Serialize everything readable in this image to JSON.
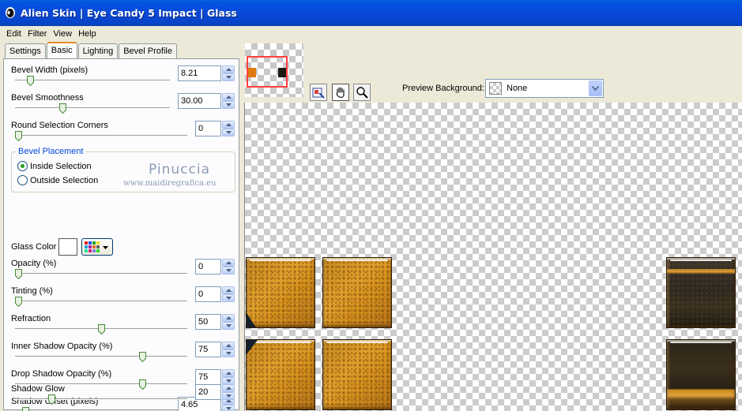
{
  "window": {
    "title": "Alien Skin | Eye Candy 5 Impact | Glass"
  },
  "menu": [
    "Edit",
    "Filter",
    "View",
    "Help"
  ],
  "tabs": [
    "Settings",
    "Basic",
    "Lighting",
    "Bevel Profile"
  ],
  "active_tab": "Basic",
  "controls": {
    "bevel_width": {
      "label": "Bevel Width (pixels)",
      "value": "8.21",
      "fraction": 0.08
    },
    "bevel_smoothness": {
      "label": "Bevel Smoothness",
      "value": "30.00",
      "fraction": 0.3
    },
    "round_corners": {
      "label": "Round Selection Corners",
      "value": "0",
      "fraction": 0.0
    },
    "bevel_placement": {
      "legend": "Bevel Placement",
      "options": [
        "Inside Selection",
        "Outside Selection"
      ],
      "selected": "Inside Selection"
    },
    "glass_color": {
      "label": "Glass Color",
      "color": "#ffffff"
    },
    "opacity": {
      "label": "Opacity (%)",
      "value": "0",
      "fraction": 0.0
    },
    "tinting": {
      "label": "Tinting (%)",
      "value": "0",
      "fraction": 0.0
    },
    "refraction": {
      "label": "Refraction",
      "value": "50",
      "fraction": 0.5
    },
    "inner_shadow_opacity": {
      "label": "Inner Shadow Opacity (%)",
      "value": "75",
      "fraction": 0.75
    },
    "drop_shadow_opacity": {
      "label": "Drop Shadow Opacity (%)",
      "value": "75",
      "fraction": 0.75
    },
    "shadow_offset": {
      "label": "Shadow Offset (pixels)",
      "value": "4.65",
      "fraction": 0.05
    },
    "shadow_glow": {
      "label": "Shadow Glow",
      "value": "20",
      "fraction": 0.2
    }
  },
  "watermark": {
    "name": "Pinuccia",
    "site": "www.maidiregrafica.eu"
  },
  "preview": {
    "background_label": "Preview Background:",
    "background_value": "None"
  },
  "colors": {
    "title_bar": "#0848d6",
    "tab_highlight": "#e68b2c",
    "glass_tile": "#d8921f"
  },
  "icons": [
    "alien-skin-app-icon",
    "navigator-icon",
    "hand-tool-icon",
    "zoom-tool-icon",
    "chevron-down-icon",
    "color-swatch-icon"
  ]
}
